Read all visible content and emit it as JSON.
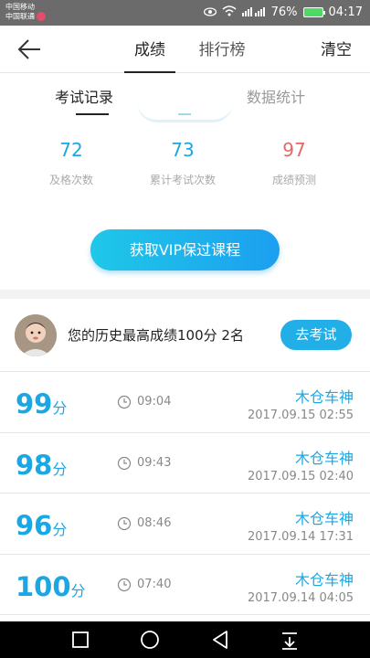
{
  "status_bar": {
    "carrier_1": "中国移动",
    "carrier_2": "中国联通",
    "battery_percent": "76%",
    "time": "04:17",
    "icons": [
      "eye-icon",
      "wifi-icon",
      "signal-icon",
      "battery-icon"
    ]
  },
  "header": {
    "tabs": [
      {
        "label": "成绩",
        "active": true
      },
      {
        "label": "排行榜",
        "active": false
      }
    ],
    "clear_label": "清空"
  },
  "subtabs": [
    {
      "label": "考试记录",
      "active": true
    },
    {
      "label": "数据统计",
      "active": false
    }
  ],
  "stats": [
    {
      "value": "72",
      "label": "及格次数",
      "color": "#1ba7e3"
    },
    {
      "value": "73",
      "label": "累计考试次数",
      "color": "#1ba7e3"
    },
    {
      "value": "97",
      "label": "成绩预测",
      "color": "#e06a6a"
    }
  ],
  "vip_button": "获取VIP保过课程",
  "best": {
    "text": "您的历史最高成绩100分  2名",
    "exam_button": "去考试"
  },
  "records": [
    {
      "score": "99",
      "unit": "分",
      "time": "09:04",
      "name": "木仓车神",
      "date": "2017.09.15  02:55"
    },
    {
      "score": "98",
      "unit": "分",
      "time": "09:43",
      "name": "木仓车神",
      "date": "2017.09.15  02:40"
    },
    {
      "score": "96",
      "unit": "分",
      "time": "08:46",
      "name": "木仓车神",
      "date": "2017.09.14  17:31"
    },
    {
      "score": "100",
      "unit": "分",
      "time": "07:40",
      "name": "木仓车神",
      "date": "2017.09.14  04:05"
    }
  ],
  "nav": [
    "square-icon",
    "circle-icon",
    "back-triangle-icon",
    "download-icon"
  ],
  "colors": {
    "accent": "#1ba7e3",
    "prediction": "#e06a6a"
  }
}
